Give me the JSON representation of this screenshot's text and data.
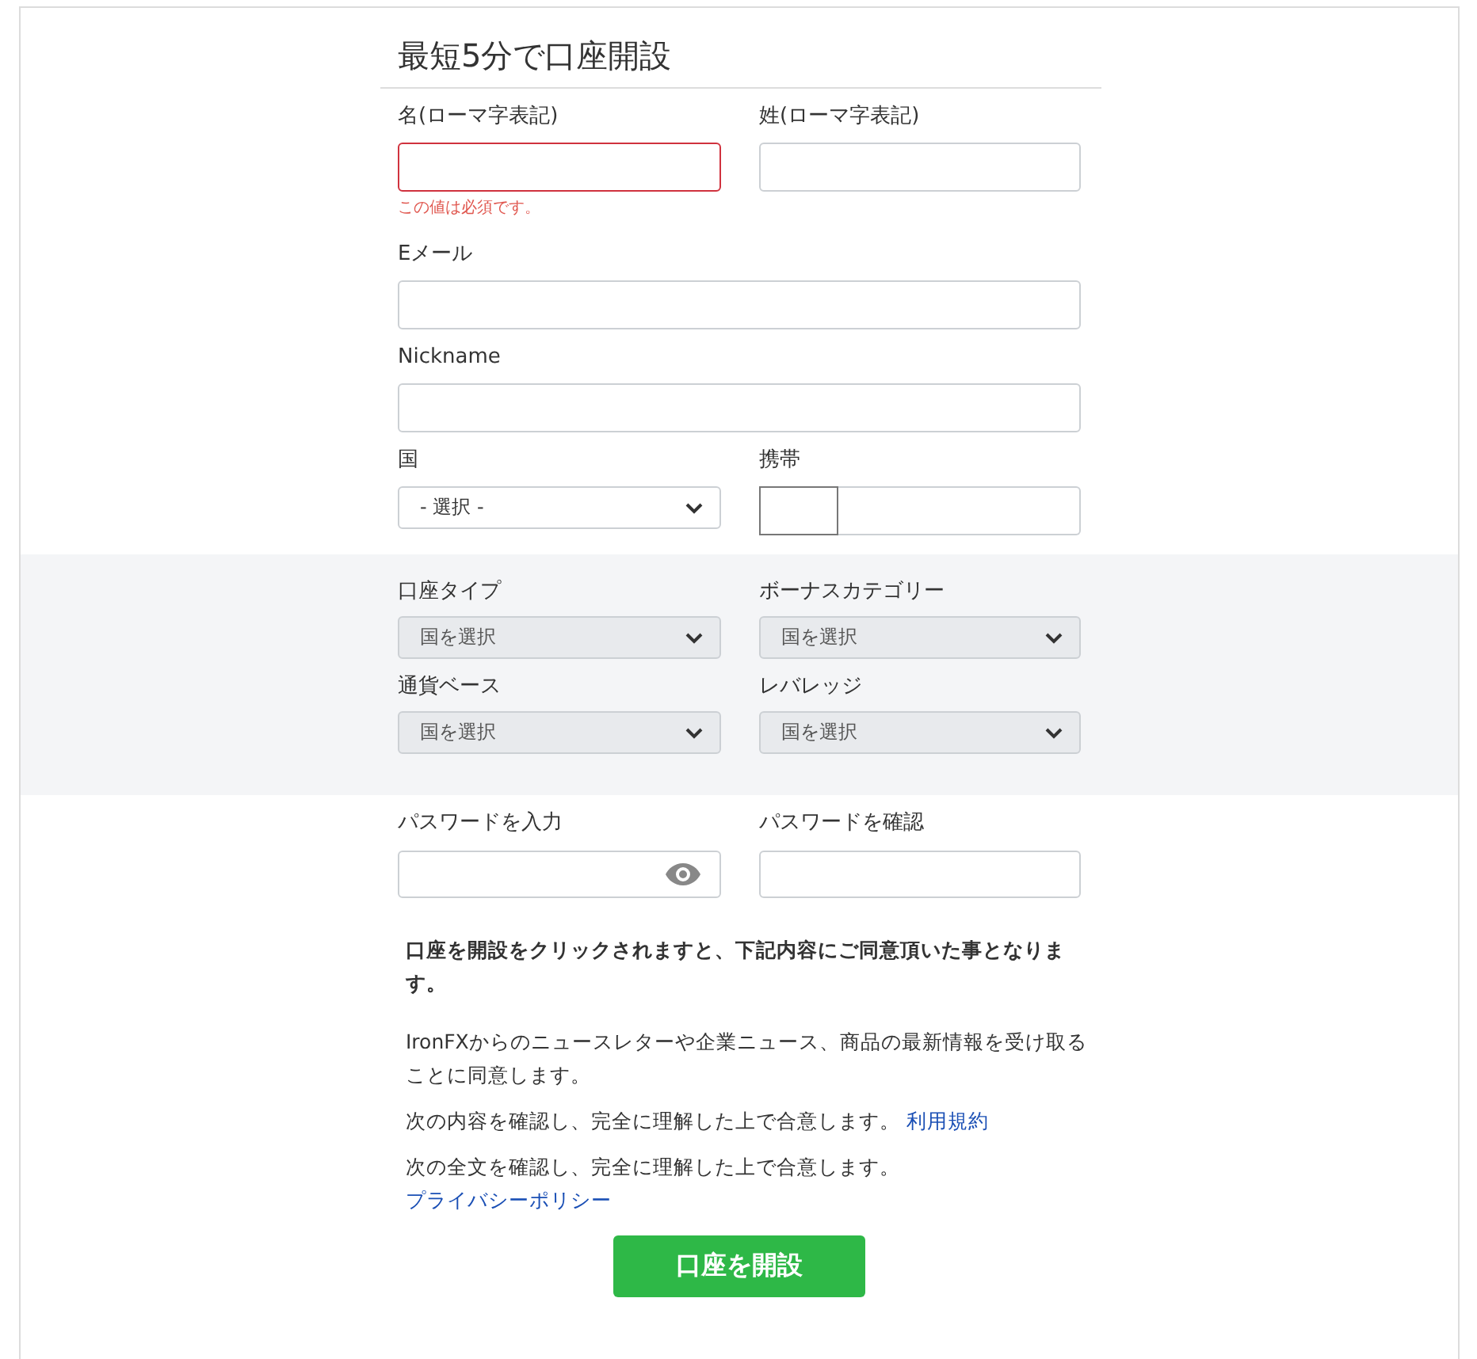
{
  "title": "最短5分で口座開設",
  "name_row": [
    {
      "label": "名(ローマ字表記)",
      "invalid": true,
      "error": "この値は必須です。"
    },
    {
      "label": "姓(ローマ字表記)",
      "invalid": false
    }
  ],
  "email": {
    "label": "Eメール"
  },
  "nickname": {
    "label": "Nickname"
  },
  "country": {
    "label": "国",
    "value": "- 選択 -"
  },
  "mobile": {
    "label": "携帯"
  },
  "account_selects": [
    {
      "label": "口座タイプ",
      "value": "国を選択",
      "disabled": true
    },
    {
      "label": "ボーナスカテゴリー",
      "value": "国を選択",
      "disabled": true
    },
    {
      "label": "通貨ベース",
      "value": "国を選択",
      "disabled": true
    },
    {
      "label": "レバレッジ",
      "value": "国を選択",
      "disabled": true
    }
  ],
  "passwords": [
    {
      "label": "パスワードを入力",
      "reveal": true
    },
    {
      "label": "パスワードを確認",
      "reveal": false
    }
  ],
  "notice": "口座を開設をクリックされますと、下記内容にご同意頂いた事となります。",
  "consents": [
    {
      "text": "IronFXからのニュースレターや企業ニュース、商品の最新情報を受け取ることに同意します。"
    },
    {
      "text": "次の内容を確認し、完全に理解した上で合意します。",
      "link": "利用規約"
    },
    {
      "text": "次の全文を確認し、完全に理解した上で合意します。",
      "link": "プライバシーポリシー"
    }
  ],
  "submit": "口座を開設"
}
